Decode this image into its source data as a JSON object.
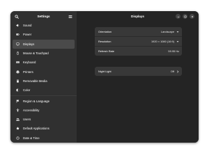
{
  "sidebar": {
    "title": "Settings",
    "items": [
      {
        "label": "Sound",
        "icon": "speaker-icon"
      },
      {
        "label": "Power",
        "icon": "power-icon"
      },
      {
        "label": "Displays",
        "icon": "display-icon",
        "active": true
      },
      {
        "label": "Mouse & Touchpad",
        "icon": "mouse-icon"
      },
      {
        "label": "Keyboard",
        "icon": "keyboard-icon"
      },
      {
        "label": "Printers",
        "icon": "printer-icon"
      },
      {
        "label": "Removable Media",
        "icon": "usb-icon"
      },
      {
        "label": "Color",
        "icon": "color-icon"
      },
      {
        "label": "Region & Language",
        "icon": "flag-icon"
      },
      {
        "label": "Accessibility",
        "icon": "accessibility-icon"
      },
      {
        "label": "Users",
        "icon": "users-icon"
      },
      {
        "label": "Default Applications",
        "icon": "star-icon"
      },
      {
        "label": "Date & Time",
        "icon": "clock-icon"
      }
    ]
  },
  "content": {
    "title": "Displays",
    "display_settings": {
      "orientation": {
        "label": "Orientation",
        "value": "Landscape"
      },
      "resolution": {
        "label": "Resolution",
        "value": "1920 × 1080 (16:9)"
      },
      "refresh_rate": {
        "label": "Refresh Rate",
        "value": "59.95 Hz"
      }
    },
    "night_light": {
      "label": "Night Light",
      "value": "Off"
    }
  },
  "colors": {
    "window_bg": "#242424",
    "sidebar_bg": "#303030",
    "card_bg": "#383838",
    "active_item_bg": "#4a4a4a"
  }
}
